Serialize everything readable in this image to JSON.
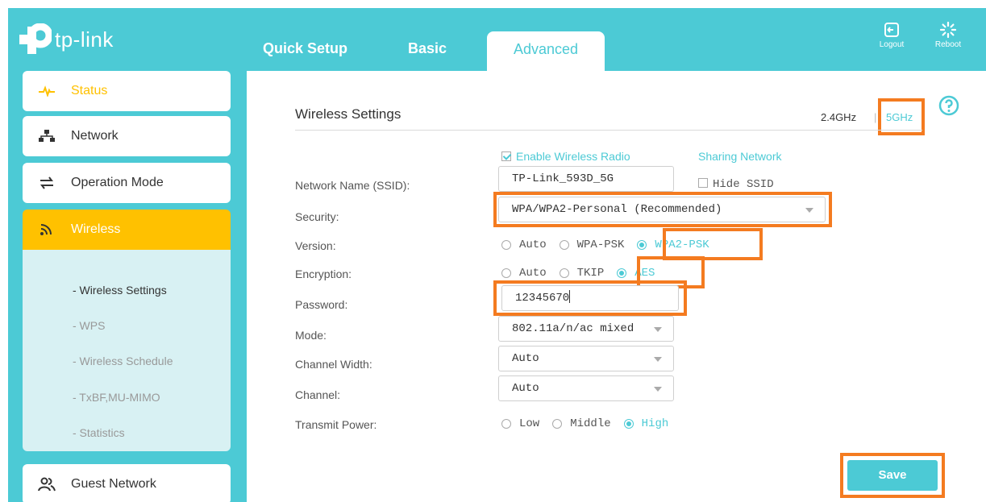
{
  "header": {
    "brand": "tp-link",
    "tabs": [
      "Quick Setup",
      "Basic",
      "Advanced"
    ],
    "logout_label": "Logout",
    "reboot_label": "Reboot"
  },
  "sidebar": {
    "items": [
      {
        "label": "Status",
        "icon": "pulse-icon"
      },
      {
        "label": "Network",
        "icon": "network-icon"
      },
      {
        "label": "Operation Mode",
        "icon": "operation-mode-icon"
      },
      {
        "label": "Wireless",
        "icon": "wifi-icon"
      },
      {
        "label": "Guest Network",
        "icon": "guest-icon"
      }
    ],
    "wireless_submenu": [
      "- Wireless Settings",
      "- WPS",
      "- Wireless Schedule",
      "- TxBF,MU-MIMO",
      "- Statistics"
    ]
  },
  "main": {
    "title": "Wireless Settings",
    "band_24": "2.4GHz",
    "band_sep": "|",
    "band_5": "5GHz",
    "enable_radio": "Enable Wireless Radio",
    "sharing_network": "Sharing Network",
    "labels": {
      "ssid": "Network Name (SSID):",
      "security": "Security:",
      "version": "Version:",
      "encryption": "Encryption:",
      "password": "Password:",
      "mode": "Mode:",
      "channel_width": "Channel Width:",
      "channel": "Channel:",
      "transmit_power": "Transmit Power:"
    },
    "ssid_value": "TP-Link_593D_5G",
    "hide_ssid": "Hide SSID",
    "security_value": "WPA/WPA2-Personal (Recommended)",
    "version_options": [
      "Auto",
      "WPA-PSK",
      "WPA2-PSK"
    ],
    "version_selected": "WPA2-PSK",
    "encryption_options": [
      "Auto",
      "TKIP",
      "AES"
    ],
    "encryption_selected": "AES",
    "password_value": "12345670",
    "mode_value": "802.11a/n/ac mixed",
    "channel_width_value": "Auto",
    "channel_value": "Auto",
    "power_options": [
      "Low",
      "Middle",
      "High"
    ],
    "power_selected": "High",
    "save_label": "Save"
  },
  "colors": {
    "teal": "#4ccad5",
    "active_yellow": "#ffc100",
    "highlight_orange": "#f47b20"
  }
}
